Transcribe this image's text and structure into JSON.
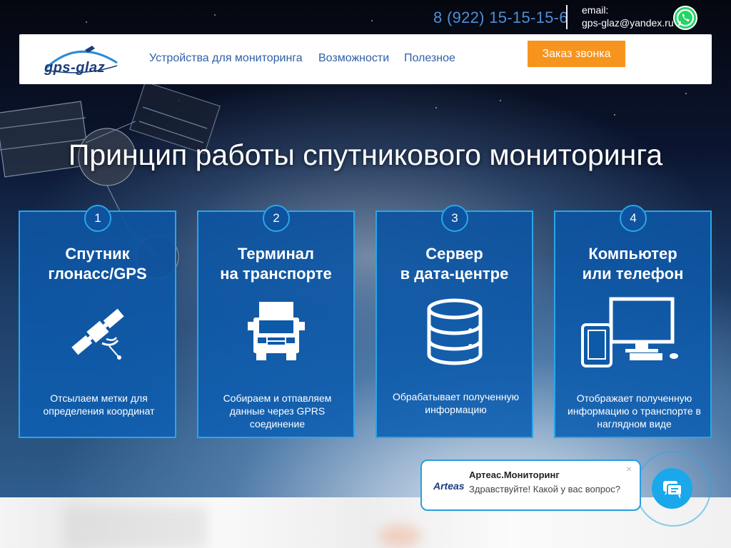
{
  "topbar": {
    "phone": "8 (922) 15-15-15-6",
    "email_label": "email:",
    "email": "gps-glaz@yandex.ru",
    "whatsapp_icon": "whatsapp-icon"
  },
  "navbar": {
    "logo_text": "gps-glaz",
    "links": [
      "Устройства для мониторинга",
      "Возможности",
      "Полезное"
    ],
    "cta_label": "Заказ звонка"
  },
  "hero": {
    "title": "Принцип работы спутникового мониторинга"
  },
  "steps": [
    {
      "number": "1",
      "title": "Спутник\nглонасс/GPS",
      "icon": "satellite-icon",
      "description": "Отсылаем метки для\nопределения координат"
    },
    {
      "number": "2",
      "title": "Терминал\nна транспорте",
      "icon": "truck-icon",
      "description": "Собираем и отпавляем\nданные через GPRS\nсоединение"
    },
    {
      "number": "3",
      "title": "Сервер\nв дата-центре",
      "icon": "database-icon",
      "description": "Обрабатывает полученную\nинформацию"
    },
    {
      "number": "4",
      "title": "Компьютер\nили телефон",
      "icon": "devices-icon",
      "description": "Отображает полученную\nинформацию о транспорте в\nнаглядном виде"
    }
  ],
  "chat": {
    "logo_text": "Arteas",
    "title": "Артеас.Мониторинг",
    "message": "Здравствуйте! Какой у вас вопрос?",
    "close": "×"
  },
  "colors": {
    "accent": "#f7941d",
    "nav_link": "#2f5fa8",
    "card_border": "#2aa6e8",
    "phone": "#4f8fd6"
  }
}
